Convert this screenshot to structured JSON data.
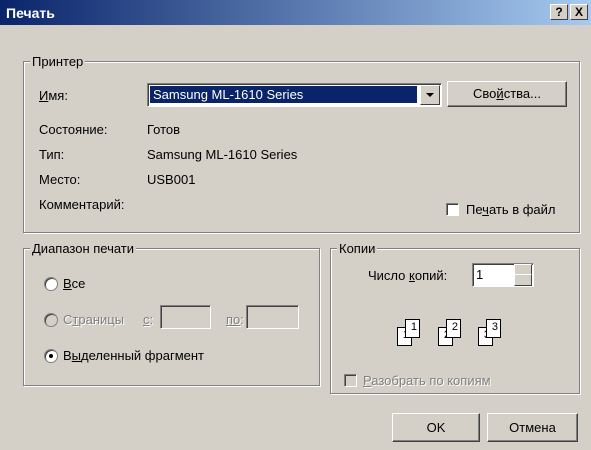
{
  "window": {
    "title": "Печать",
    "help_btn": "?",
    "close_btn": "X"
  },
  "printer": {
    "group_label": "Принтер",
    "name_label": "Имя:",
    "name_value": "Samsung ML-1610 Series",
    "properties_btn": "Свойства...",
    "status_label": "Состояние:",
    "status_value": "Готов",
    "type_label": "Тип:",
    "type_value": "Samsung ML-1610 Series",
    "location_label": "Место:",
    "location_value": "USB001",
    "comment_label": "Комментарий:",
    "print_to_file": "Печать в файл"
  },
  "range": {
    "group_label": "Диапазон печати",
    "all": "Все",
    "pages": "Страницы",
    "from_label": "с:",
    "to_label": "по:",
    "selection": "Выделенный фрагмент",
    "selected": "selection"
  },
  "copies": {
    "group_label": "Копии",
    "count_label": "Число копий:",
    "count_value": "1",
    "pages_icons": [
      "1",
      "1",
      "2",
      "2",
      "3",
      "3"
    ],
    "collate": "Разобрать по копиям"
  },
  "buttons": {
    "ok": "OK",
    "cancel": "Отмена"
  }
}
